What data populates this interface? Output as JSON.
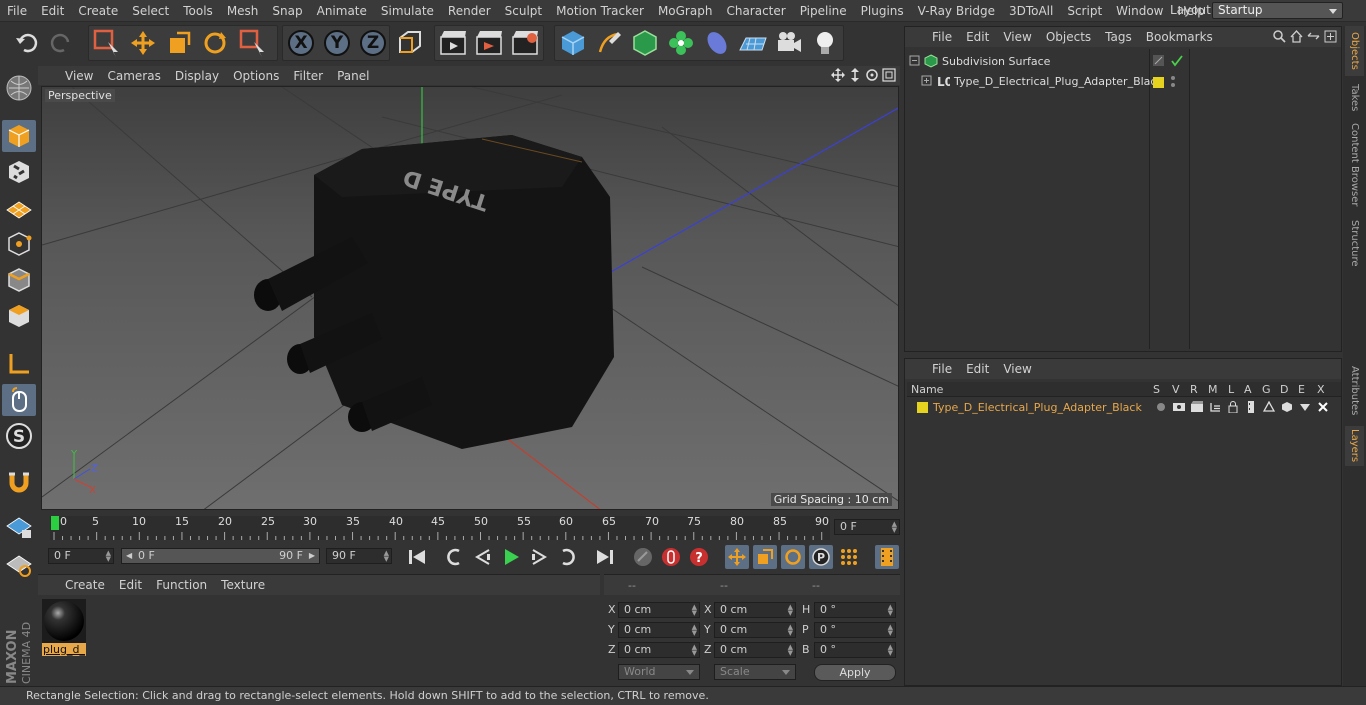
{
  "menubar": {
    "items": [
      "File",
      "Edit",
      "Create",
      "Select",
      "Tools",
      "Mesh",
      "Snap",
      "Animate",
      "Simulate",
      "Render",
      "Sculpt",
      "Motion Tracker",
      "MoGraph",
      "Character",
      "Pipeline",
      "Plugins",
      "V-Ray Bridge",
      "3DToAll",
      "Script",
      "Window",
      "Help"
    ],
    "layout_label": "Layout:",
    "layout_value": "Startup"
  },
  "toolbar": {
    "axis_x": "X",
    "axis_y": "Y",
    "axis_z": "Z"
  },
  "viewport": {
    "menu": [
      "View",
      "Cameras",
      "Display",
      "Options",
      "Filter",
      "Panel"
    ],
    "label": "Perspective",
    "grid_spacing": "Grid Spacing : 10 cm",
    "model_text": "TYPE D",
    "axis_labels": {
      "y": "Y",
      "z": "Z",
      "x": "X"
    }
  },
  "timeline": {
    "ticks": [
      "0",
      "5",
      "10",
      "15",
      "20",
      "25",
      "30",
      "35",
      "40",
      "45",
      "50",
      "55",
      "60",
      "65",
      "70",
      "75",
      "80",
      "85",
      "90"
    ],
    "current_frame": "0 F"
  },
  "playback": {
    "start_field": "0 F",
    "range_start": "0 F",
    "range_end": "90 F",
    "end_field": "90 F"
  },
  "material_panel": {
    "menu": [
      "Create",
      "Edit",
      "Function",
      "Texture"
    ],
    "material_name": "plug_d_"
  },
  "coord_panel": {
    "headers": [
      "--",
      "--",
      "--"
    ],
    "rows": [
      {
        "a": "X",
        "av": "0 cm",
        "b": "X",
        "bv": "0 cm",
        "c": "H",
        "cv": "0 °"
      },
      {
        "a": "Y",
        "av": "0 cm",
        "b": "Y",
        "bv": "0 cm",
        "c": "P",
        "cv": "0 °"
      },
      {
        "a": "Z",
        "av": "0 cm",
        "b": "Z",
        "bv": "0 cm",
        "c": "B",
        "cv": "0 °"
      }
    ],
    "world": "World",
    "scale": "Scale",
    "apply": "Apply"
  },
  "object_panel": {
    "menu": [
      "File",
      "Edit",
      "View",
      "Objects",
      "Tags",
      "Bookmarks"
    ],
    "objects": [
      "Subdivision Surface",
      "Type_D_Electrical_Plug_Adapter_Black"
    ]
  },
  "layer_panel": {
    "menu": [
      "File",
      "Edit",
      "View"
    ],
    "col_name": "Name",
    "cols": [
      "S",
      "V",
      "R",
      "M",
      "L",
      "A",
      "G",
      "D",
      "E",
      "X"
    ],
    "layer_name": "Type_D_Electrical_Plug_Adapter_Black"
  },
  "right_tabs": [
    "Objects",
    "Takes",
    "Content Browser",
    "Structure",
    "Attributes",
    "Layers"
  ],
  "status": "Rectangle Selection: Click and drag to rectangle-select elements. Hold down SHIFT to add to the selection, CTRL to remove.",
  "branding": {
    "maxon": "MAXON",
    "c4d": "CINEMA 4D"
  },
  "colors": {
    "accent": "#e8a84a",
    "layer_yellow": "#e6d320",
    "active_tool": "#5d6f84"
  }
}
